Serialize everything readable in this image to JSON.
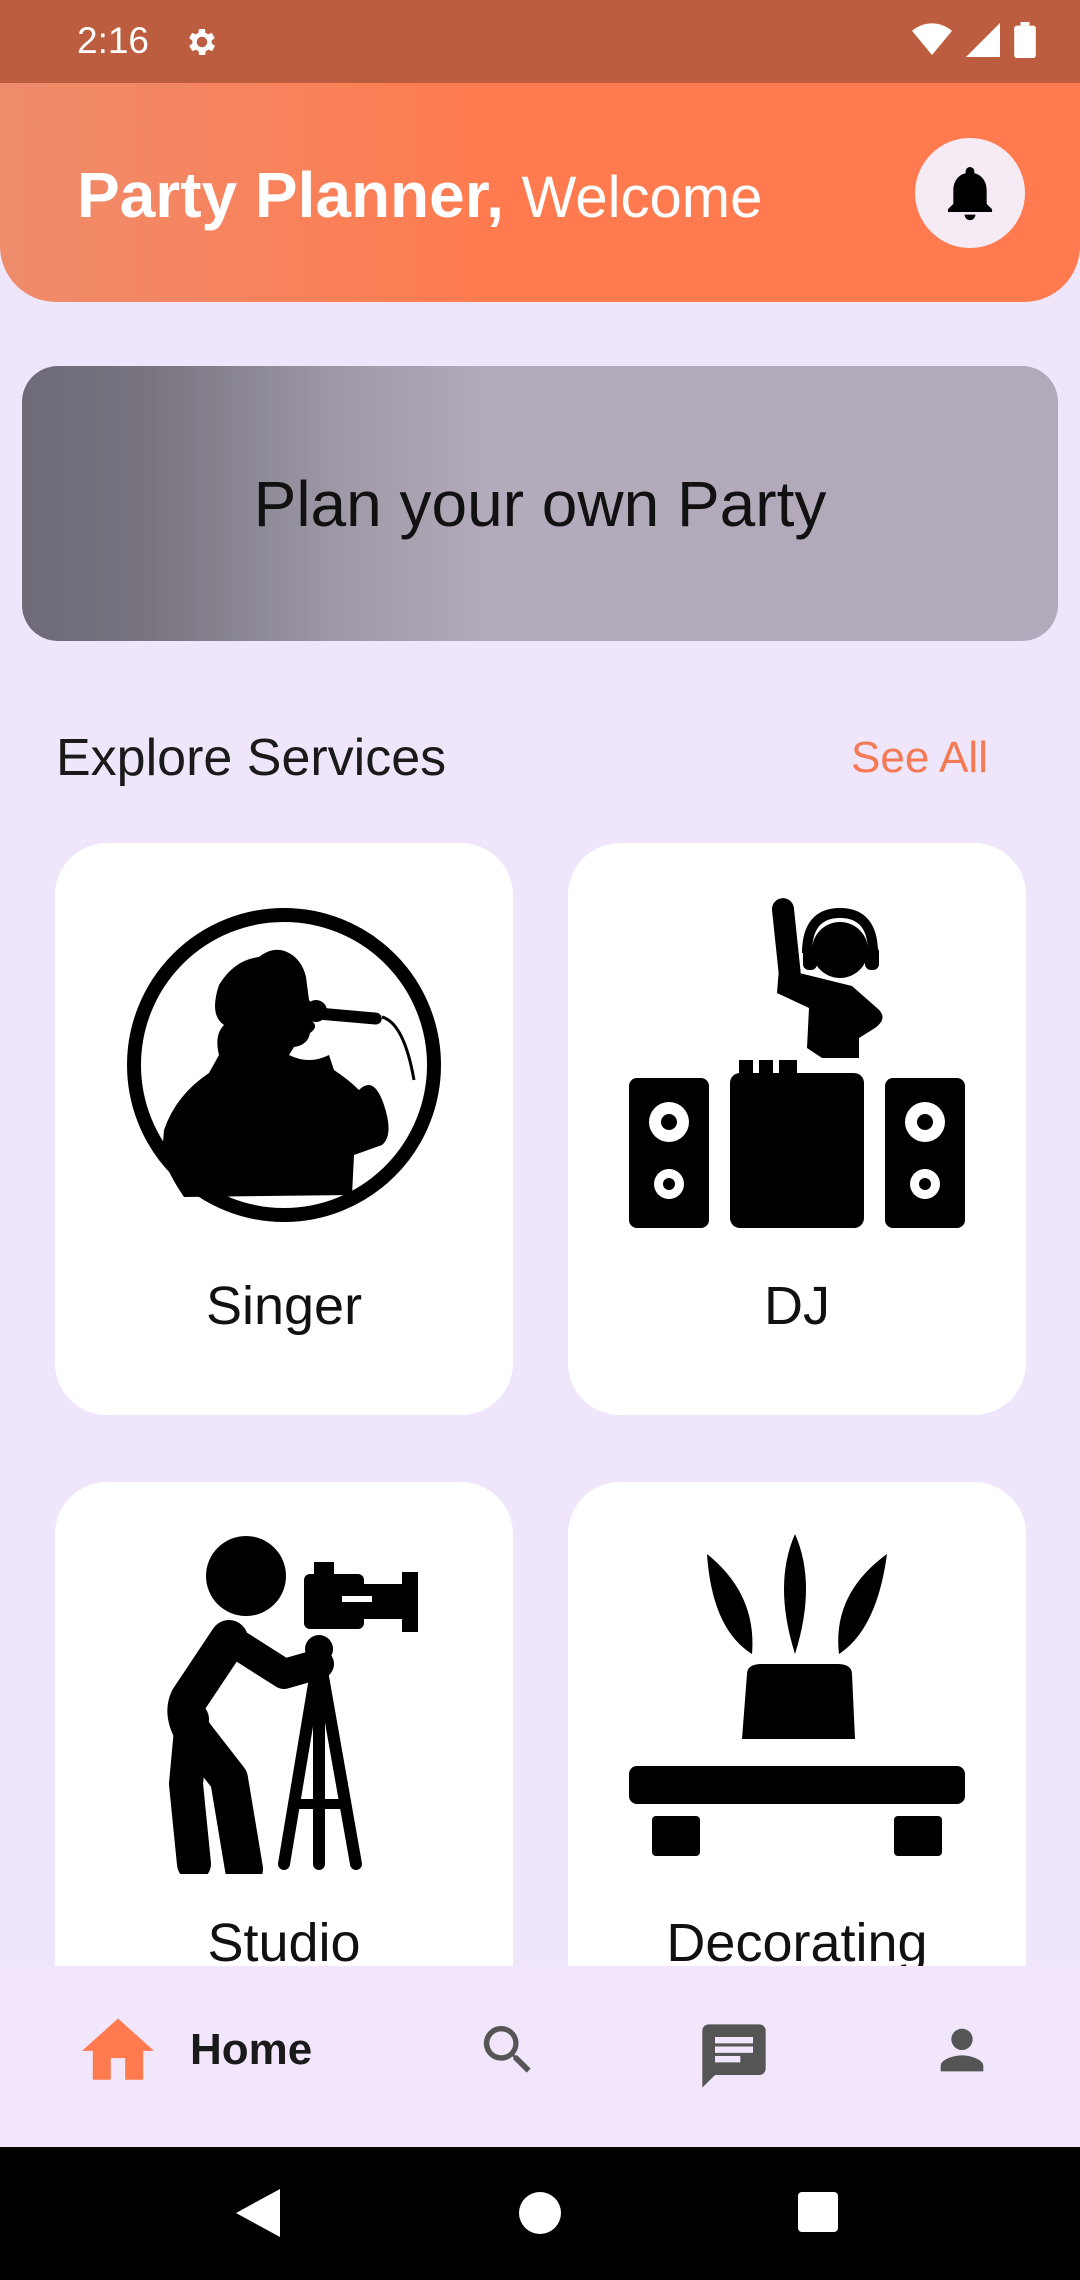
{
  "status_bar": {
    "time": "2:16",
    "icons": [
      "gear-icon",
      "wifi-icon",
      "signal-icon",
      "battery-icon"
    ]
  },
  "header": {
    "brand": "Party Planner,",
    "welcome": "Welcome",
    "notification_icon": "bell-icon"
  },
  "banner": {
    "text": "Plan your own Party"
  },
  "services": {
    "title": "Explore Services",
    "see_all": "See All",
    "items": [
      {
        "label": "Singer",
        "icon": "singer-icon"
      },
      {
        "label": "DJ",
        "icon": "dj-icon"
      },
      {
        "label": "Studio",
        "icon": "camera-operator-icon"
      },
      {
        "label": "Decorating",
        "icon": "plant-table-icon"
      }
    ]
  },
  "bottom_nav": {
    "home_label": "Home",
    "items": [
      "home-icon",
      "search-icon",
      "chat-icon",
      "profile-icon"
    ]
  },
  "colors": {
    "accent": "#FF7B4F",
    "status_bar": "#BC5D3F",
    "background": "#EFE6FC",
    "see_all": "#F47A55"
  }
}
